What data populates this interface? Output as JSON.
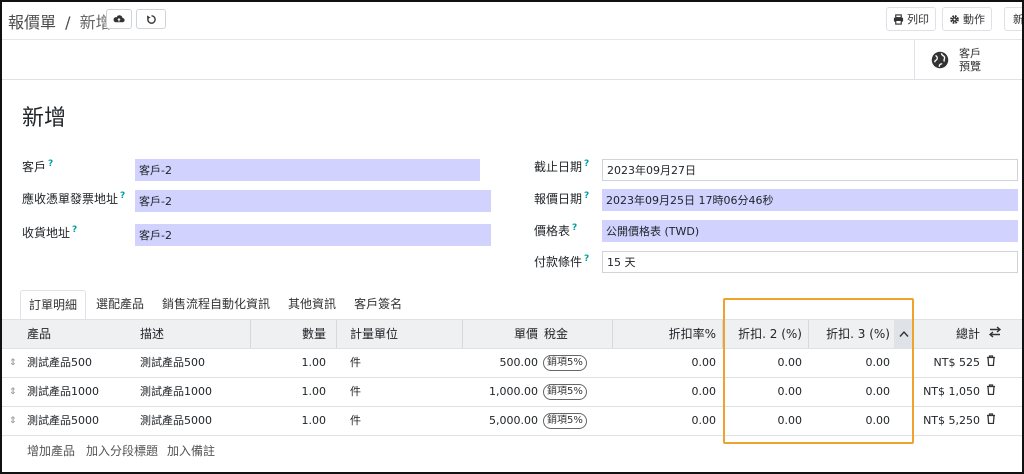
{
  "breadcrumb": {
    "parent": "報價單",
    "separator": "/",
    "current": "新增"
  },
  "toolbar": {
    "print_label": "列印",
    "action_label": "動作",
    "new_label": "新"
  },
  "smart_button": {
    "line1": "客戶",
    "line2": "預覽"
  },
  "form": {
    "title": "新增",
    "left_fields": [
      {
        "label": "客戶",
        "value": "客戶-2"
      },
      {
        "label": "應收憑單發票地址",
        "value": "客戶-2"
      },
      {
        "label": "收貨地址",
        "value": "客戶-2"
      }
    ],
    "right_fields": [
      {
        "label": "截止日期",
        "value": "2023年09月27日"
      },
      {
        "label": "報價日期",
        "value": "2023年09月25日 17時06分46秒"
      },
      {
        "label": "價格表",
        "value": "公開價格表 (TWD)"
      },
      {
        "label": "付款條件",
        "value": "15 天"
      }
    ],
    "help_mark": "?"
  },
  "tabs": [
    "訂單明細",
    "選配產品",
    "銷售流程自動化資訊",
    "其他資訊",
    "客戶簽名"
  ],
  "table": {
    "headers": {
      "product": "產品",
      "description": "描述",
      "quantity": "數量",
      "uom": "計量單位",
      "price": "單價",
      "tax": "稅金",
      "discount": "折扣率%",
      "discount2": "折扣. 2 (%)",
      "discount3": "折扣. 3 (%)",
      "total": "總計"
    },
    "rows": [
      {
        "product": "測試產品500",
        "description": "測試產品500",
        "quantity": "1.00",
        "uom": "件",
        "price": "500.00",
        "tax": "銷項5%",
        "discount": "0.00",
        "discount2": "0.00",
        "discount3": "0.00",
        "total": "NT$ 525"
      },
      {
        "product": "測試產品1000",
        "description": "測試產品1000",
        "quantity": "1.00",
        "uom": "件",
        "price": "1,000.00",
        "tax": "銷項5%",
        "discount": "0.00",
        "discount2": "0.00",
        "discount3": "0.00",
        "total": "NT$ 1,050"
      },
      {
        "product": "測試產品5000",
        "description": "測試產品5000",
        "quantity": "1.00",
        "uom": "件",
        "price": "5,000.00",
        "tax": "銷項5%",
        "discount": "0.00",
        "discount2": "0.00",
        "discount3": "0.00",
        "total": "NT$ 5,250"
      }
    ],
    "footer_links": [
      "增加產品",
      "加入分段標題",
      "加入備註"
    ]
  },
  "colors": {
    "required_field": "#D2D2FF",
    "highlight_box": "#F0A22E",
    "help_mark": "#00A09D"
  }
}
